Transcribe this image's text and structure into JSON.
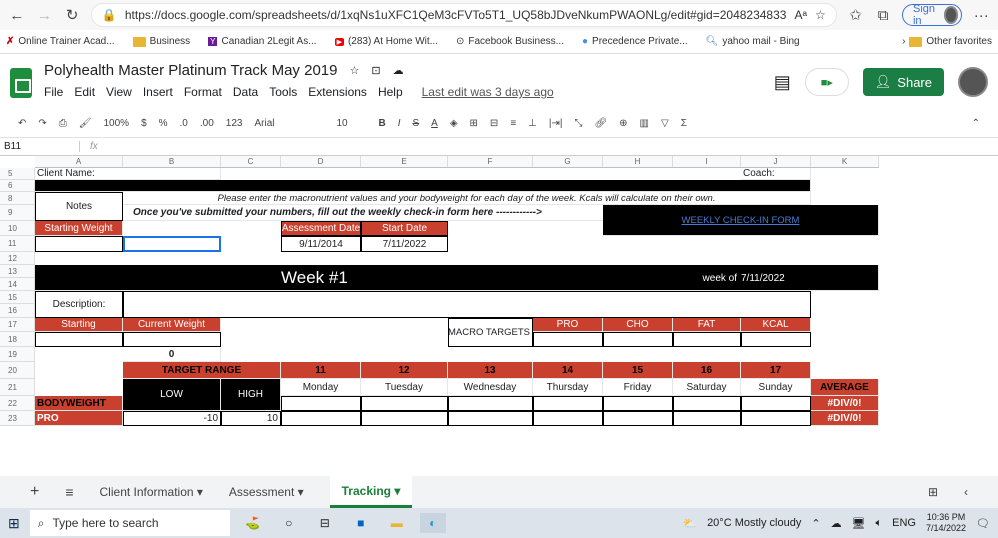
{
  "browser": {
    "url": "https://docs.google.com/spreadsheets/d/1xqNs1uXFC1QeM3cFVTo5T1_UQ58bJDveNkumPWAONLg/edit#gid=2048234833",
    "signin": "Sign in"
  },
  "bookmarks": [
    "Online Trainer Acad...",
    "Business",
    "Canadian 2Legit As...",
    "(283) At Home Wit...",
    "Facebook Business...",
    "Precedence Private...",
    "yahoo mail - Bing"
  ],
  "other_favs": "Other favorites",
  "doc": {
    "title": "Polyhealth Master Platinum Track May 2019",
    "last_edit": "Last edit was 3 days ago",
    "share": "Share"
  },
  "menu": [
    "File",
    "Edit",
    "View",
    "Insert",
    "Format",
    "Data",
    "Tools",
    "Extensions",
    "Help"
  ],
  "toolbar": {
    "zoom": "100%",
    "currency": "$",
    "percent": "%",
    "dec0": ".0",
    "dec00": ".00",
    "numfmt": "123",
    "font": "Arial",
    "size": "10"
  },
  "namebox": "B11",
  "cols": [
    "A",
    "B",
    "C",
    "D",
    "E",
    "F",
    "G",
    "H",
    "I",
    "J",
    "K"
  ],
  "rows": [
    "5",
    "6",
    "8",
    "9",
    "10",
    "11",
    "12",
    "13",
    "14",
    "15",
    "16",
    "17",
    "18",
    "19",
    "20",
    "21",
    "22",
    "23"
  ],
  "sheet": {
    "client_name": "Client Name:",
    "coach": "Coach:",
    "notes": "Notes",
    "instr1": "Please enter the macronutrient values and your bodyweight for each day of the week. Kcals will calculate on their own.",
    "instr2": "Once you've submitted your numbers, fill out the weekly check-in form here ------------>",
    "checkin": "WEEKLY CHECK-IN FORM",
    "starting_weight": "Starting Weight",
    "assess_date_h": "Assessment Date",
    "start_date_h": "Start Date",
    "assess_date": "9/11/2014",
    "start_date": "7/11/2022",
    "week": "Week #1",
    "week_of": "week of",
    "week_date": "7/11/2022",
    "description": "Description:",
    "starting": "Starting",
    "current_weight": "Current Weight",
    "macro_targets": "MACRO TARGETS",
    "pro": "PRO",
    "cho": "CHO",
    "fat": "FAT",
    "kcal": "KCAL",
    "zero": "0",
    "target_range": "TARGET RANGE",
    "low": "LOW",
    "high": "HIGH",
    "days": [
      {
        "n": "11",
        "d": "Monday"
      },
      {
        "n": "12",
        "d": "Tuesday"
      },
      {
        "n": "13",
        "d": "Wednesday"
      },
      {
        "n": "14",
        "d": "Thursday"
      },
      {
        "n": "15",
        "d": "Friday"
      },
      {
        "n": "16",
        "d": "Saturday"
      },
      {
        "n": "17",
        "d": "Sunday"
      }
    ],
    "average": "AVERAGE",
    "bodyweight": "BODYWEIGHT",
    "pro_row": "PRO",
    "div0": "#DIV/0!",
    "low_val": "-10",
    "high_val": "10"
  },
  "tabs": [
    "Client Information",
    "Assessment",
    "Tracking"
  ],
  "taskbar": {
    "search": "Type here to search",
    "weather": "20°C  Mostly cloudy",
    "lang": "ENG",
    "time": "10:36 PM",
    "date": "7/14/2022"
  }
}
